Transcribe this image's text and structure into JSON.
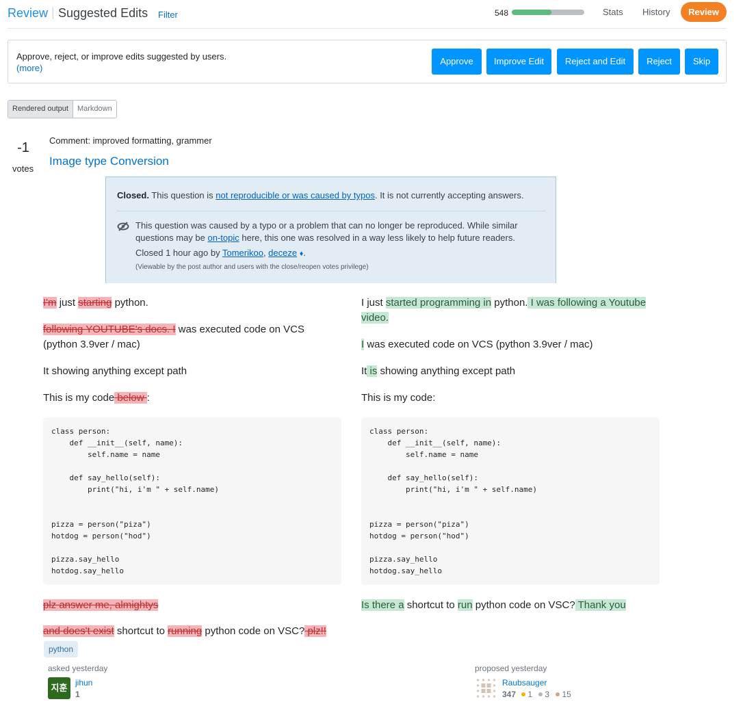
{
  "header": {
    "breadcrumb_review": "Review",
    "breadcrumb_separator": "|",
    "title": "Suggested Edits",
    "filter_label": "Filter",
    "queue_count": "548",
    "queue_progress_percent": 55,
    "nav": {
      "stats": "Stats",
      "history": "History",
      "review": "Review"
    }
  },
  "action_panel": {
    "description": "Approve, reject, or improve edits suggested by users.",
    "more_link": "(more)",
    "buttons": {
      "approve": "Approve",
      "improve_edit": "Improve Edit",
      "reject_and_edit": "Reject and Edit",
      "reject": "Reject",
      "skip": "Skip"
    }
  },
  "view_toggle": {
    "rendered": "Rendered output",
    "markdown": "Markdown",
    "selected": "Rendered output"
  },
  "post": {
    "votes": "-1",
    "votes_label": "votes",
    "comment": "Comment: improved formatting, grammer",
    "title": "Image type Conversion",
    "closed_notice": {
      "closed_label": "Closed.",
      "text_before": " This question is ",
      "reason_link": "not reproducible or was caused by typos",
      "text_after": ". It is not currently accepting answers.",
      "body_before": "This question was caused by a typo or a problem that can no longer be reproduced. While similar questions may be ",
      "on_topic_link": "on-topic",
      "body_after": " here, this one was resolved in a way less likely to help future readers.",
      "closed_by_prefix": "Closed 1 hour ago by ",
      "closer_1": "Tomerikoo",
      "comma": ", ",
      "closer_2": "deceze",
      "moderator_diamond": "♦",
      "period": ".",
      "privilege_note": "(Viewable by the post author and users with the close/reopen votes privilege)"
    }
  },
  "diff": {
    "left": {
      "p1": {
        "del1": "I'm",
        "t1": " just ",
        "del2": "starting",
        "t2": " python."
      },
      "p2": {
        "del1": "following YOUTUBE's docs. I",
        "t1": " was executed code on VCS (python 3.9ver / mac)"
      },
      "p3": {
        "t1": "It showing anything except path"
      },
      "p4": {
        "t1": "This is my code",
        "del1": " below ",
        "t2": ":"
      },
      "p5": {
        "del1": "plz answer me, almightys"
      },
      "p6": {
        "del1": "and does't exist",
        "t1": " shortcut to ",
        "del2": "running",
        "t2": " python code on VSC?",
        "del3": " plz!!"
      }
    },
    "right": {
      "p1": {
        "t1": "I just ",
        "ins1": "started programming in",
        "t2": " python.",
        "ins2": " I was following a Youtube video."
      },
      "p2": {
        "ins1": "I",
        "t1": " was executed code on VCS (python 3.9ver / mac)"
      },
      "p3": {
        "t1": "It",
        "ins1": " is",
        "t2": " showing anything except path"
      },
      "p4": {
        "t1": "This is my code:"
      },
      "p5": {
        "ins1": "Is there a",
        "t1": " shortcut to ",
        "ins2": "run",
        "t2": " python code on VSC?",
        "ins3": " Thank you"
      }
    },
    "code": "class person:\n    def __init__(self, name):\n        self.name = name\n\n    def say_hello(self):\n        print(\"hi, i'm \" + self.name)\n\n\npizza = person(\"piza\")\nhotdog = person(\"hod\")\n\npizza.say_hello\nhotdog.say_hello",
    "tags": [
      "python"
    ]
  },
  "asker": {
    "action": "asked yesterday",
    "avatar_text": "지훈",
    "name": "jihun",
    "reputation": "1"
  },
  "editor": {
    "action": "proposed yesterday",
    "name": "Raubsauger",
    "reputation": "347",
    "gold": "1",
    "silver": "3",
    "bronze": "15"
  },
  "colors": {
    "accent_blue": "#0095ff",
    "review_orange": "#f48024",
    "progress_green": "#5eba7d",
    "deleted_bg": "#f4b4b8",
    "inserted_bg": "#c7e7d5"
  }
}
